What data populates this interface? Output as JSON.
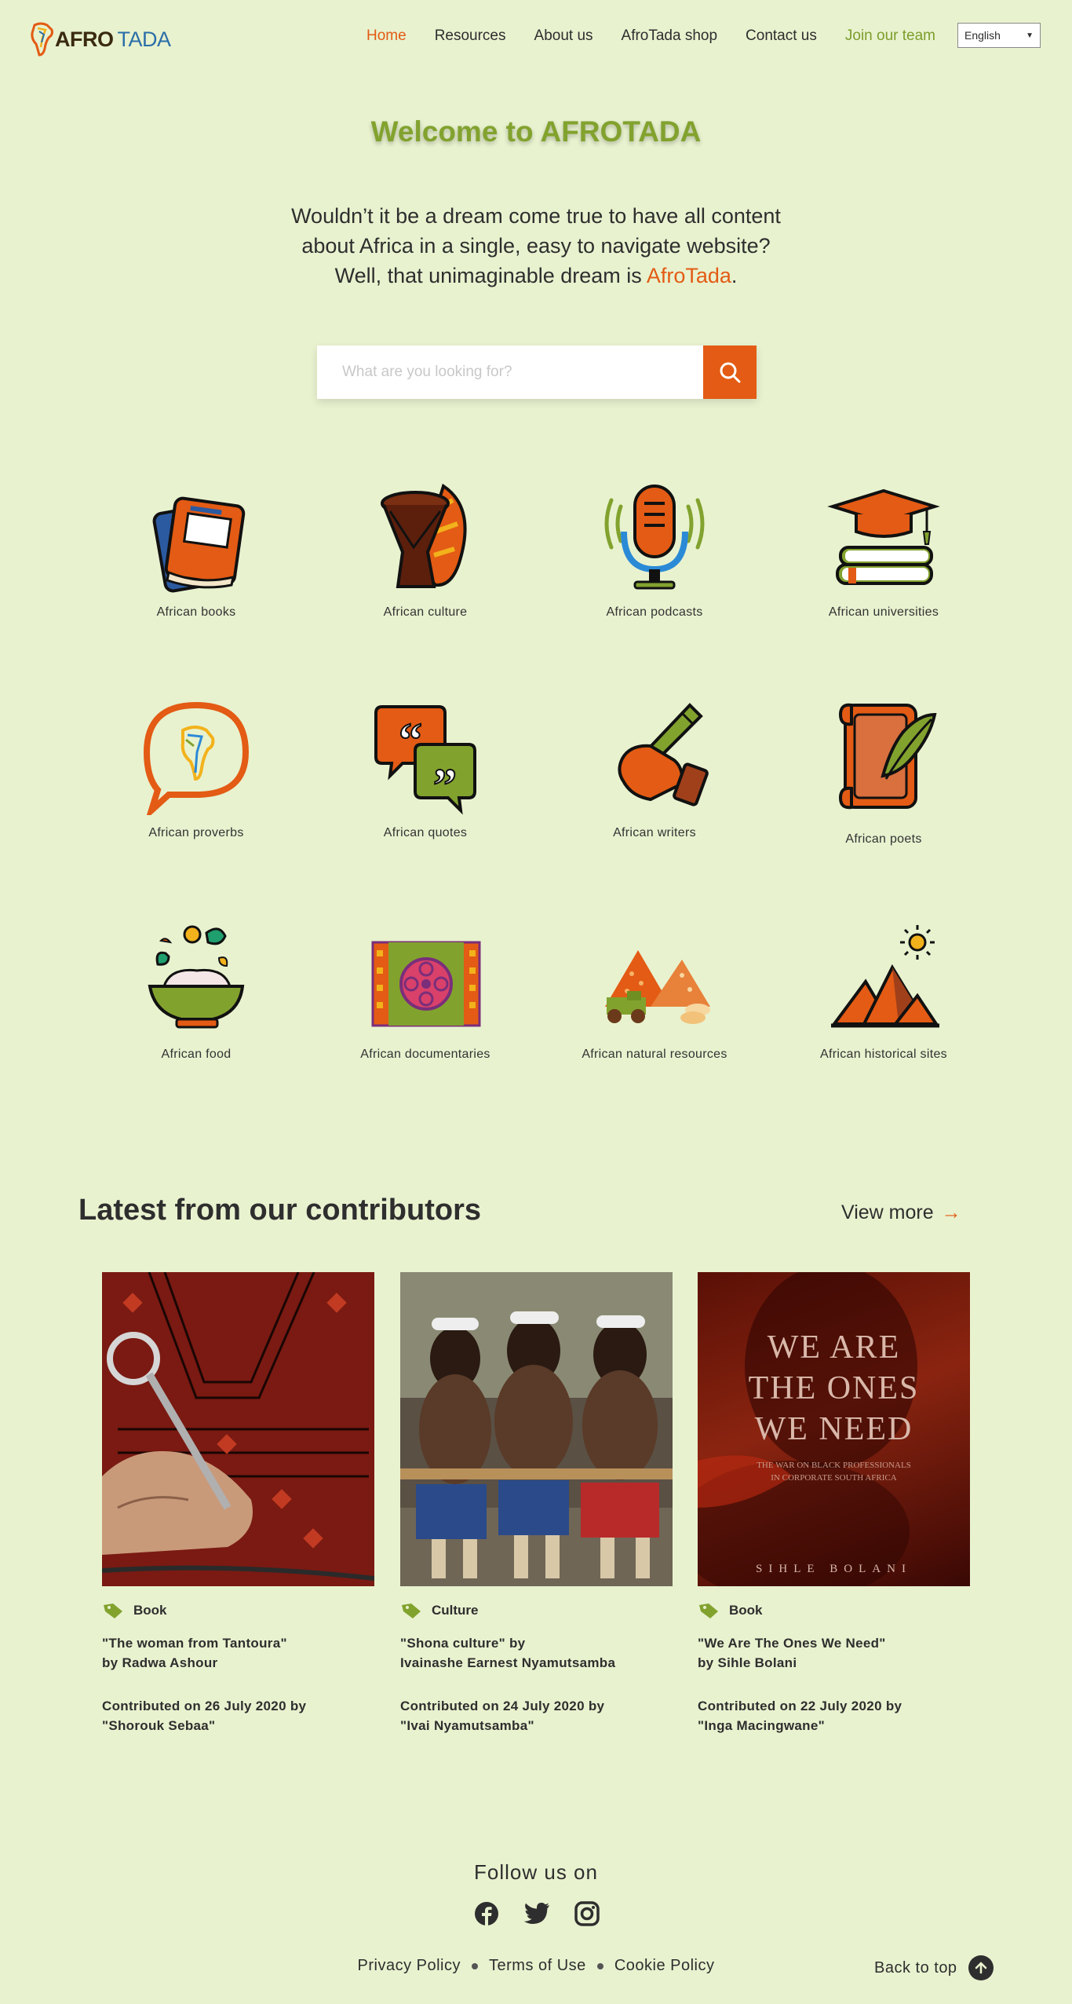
{
  "header": {
    "logo_primary": "AFRO",
    "logo_secondary": "TADA",
    "nav": [
      {
        "label": "Home",
        "state": "active"
      },
      {
        "label": "Resources"
      },
      {
        "label": "About us"
      },
      {
        "label": "AfroTada shop"
      },
      {
        "label": "Contact us"
      },
      {
        "label": "Join our team",
        "state": "highlight"
      }
    ],
    "language": "English"
  },
  "hero": {
    "title": "Welcome to AFROTADA",
    "line1": "Wouldn’t it be a dream come true to have all content",
    "line2": "about Africa in a single, easy to navigate website?",
    "line3_prefix": "Well, that unimaginable dream is ",
    "line3_brand": "AfroTada",
    "line3_suffix": ".",
    "search_placeholder": "What are you looking for?"
  },
  "categories": [
    {
      "label": "African books",
      "icon": "books-icon"
    },
    {
      "label": "African culture",
      "icon": "drum-icon"
    },
    {
      "label": "African podcasts",
      "icon": "microphone-icon"
    },
    {
      "label": "African universities",
      "icon": "graduation-cap-icon"
    },
    {
      "label": "African proverbs",
      "icon": "speech-bubble-icon"
    },
    {
      "label": "African quotes",
      "icon": "quotes-icon"
    },
    {
      "label": "African writers",
      "icon": "pen-hand-icon"
    },
    {
      "label": "African poets",
      "icon": "scroll-feather-icon"
    },
    {
      "label": "African food",
      "icon": "food-bowl-icon"
    },
    {
      "label": "African documentaries",
      "icon": "film-reel-icon"
    },
    {
      "label": "African natural resources",
      "icon": "mining-icon"
    },
    {
      "label": "African historical sites",
      "icon": "pyramids-icon"
    }
  ],
  "latest": {
    "title": "Latest from our contributors",
    "view_more": "View more",
    "cards": [
      {
        "tag": "Book",
        "title_line1": "\"The woman from Tantoura\"",
        "title_line2": "by Radwa Ashour",
        "contrib_line1": "Contributed on 26 July 2020 by",
        "contrib_line2": "\"Shorouk Sebaa\""
      },
      {
        "tag": "Culture",
        "title_line1": "\"Shona culture\" by",
        "title_line2": "Ivainashe Earnest Nyamutsamba",
        "contrib_line1": "Contributed on 24 July 2020 by",
        "contrib_line2": "\"Ivai Nyamutsamba\""
      },
      {
        "tag": "Book",
        "title_line1": "\"We Are The Ones We Need\"",
        "title_line2": "by Sihle Bolani",
        "contrib_line1": "Contributed on 22 July 2020 by",
        "contrib_line2": "\"Inga Macingwane\"",
        "cover_title_1": "WE ARE",
        "cover_title_2": "THE ONES",
        "cover_title_3": "WE NEED",
        "cover_sub_1": "THE WAR ON BLACK PROFESSIONALS",
        "cover_sub_2": "IN CORPORATE SOUTH AFRICA",
        "cover_author": "SIHLE BOLANI"
      }
    ]
  },
  "footer": {
    "follow": "Follow us on",
    "links": [
      "Privacy Policy",
      "Terms of Use",
      "Cookie Policy"
    ],
    "back_to_top": "Back to top"
  },
  "colors": {
    "background": "#e8f2cf",
    "accent_orange": "#e35b14",
    "accent_green": "#82a22e",
    "text": "#2e2e2e"
  }
}
